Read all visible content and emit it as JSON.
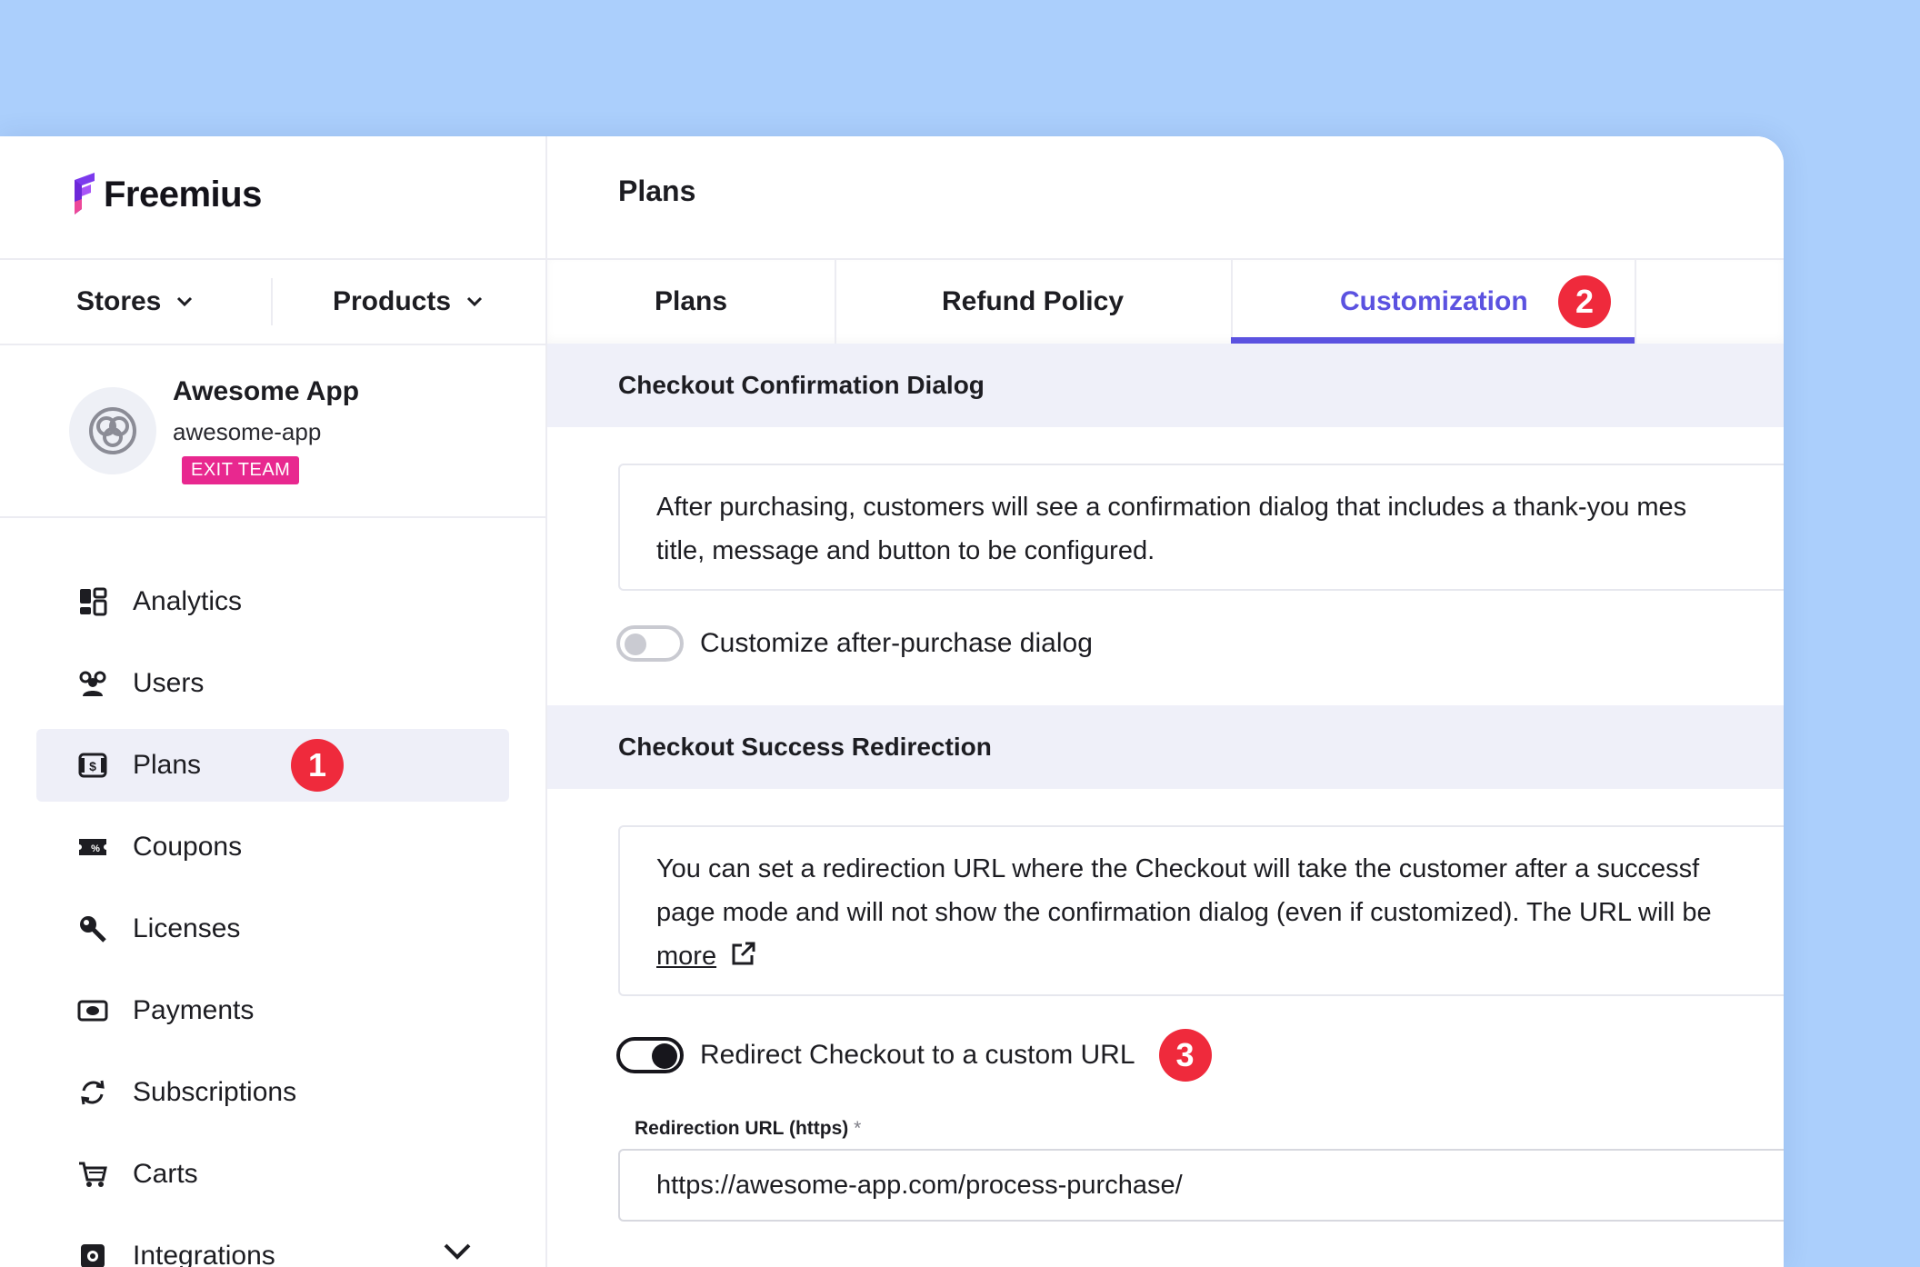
{
  "brand": {
    "name": "Freemius"
  },
  "selectors": {
    "stores": "Stores",
    "products": "Products"
  },
  "team": {
    "name": "Awesome App",
    "slug": "awesome-app",
    "exit_label": "EXIT TEAM"
  },
  "nav": {
    "items": [
      {
        "label": "Analytics",
        "icon": "analytics-icon"
      },
      {
        "label": "Users",
        "icon": "users-icon"
      },
      {
        "label": "Plans",
        "icon": "plans-icon",
        "active": true,
        "badge": "1"
      },
      {
        "label": "Coupons",
        "icon": "coupons-icon"
      },
      {
        "label": "Licenses",
        "icon": "licenses-icon"
      },
      {
        "label": "Payments",
        "icon": "payments-icon"
      },
      {
        "label": "Subscriptions",
        "icon": "subscriptions-icon"
      },
      {
        "label": "Carts",
        "icon": "carts-icon"
      },
      {
        "label": "Integrations",
        "icon": "integrations-icon"
      }
    ]
  },
  "page": {
    "title": "Plans"
  },
  "tabs": [
    {
      "label": "Plans"
    },
    {
      "label": "Refund Policy"
    },
    {
      "label": "Customization",
      "active": true,
      "badge": "2"
    }
  ],
  "confirmation": {
    "heading": "Checkout Confirmation Dialog",
    "line1": "After purchasing, customers will see a confirmation dialog that includes a thank-you mes",
    "line2": "title, message and button to be configured.",
    "toggle_label": "Customize after-purchase dialog",
    "toggle_on": false
  },
  "redirection": {
    "heading": "Checkout Success Redirection",
    "line1": "You can set a redirection URL where the Checkout will take the customer after a successf",
    "line2": "page mode and will not show the confirmation dialog (even if customized). The URL will be",
    "more": "more",
    "toggle_label": "Redirect Checkout to a custom URL",
    "toggle_on": true,
    "badge": "3",
    "field_label": "Redirection URL (https)",
    "field_required": "*",
    "field_value": "https://awesome-app.com/process-purchase/"
  },
  "colors": {
    "accent": "#5b52e0",
    "badge_red": "#ef2a3c",
    "exit_pink": "#e8288f",
    "background": "#abcffc"
  }
}
